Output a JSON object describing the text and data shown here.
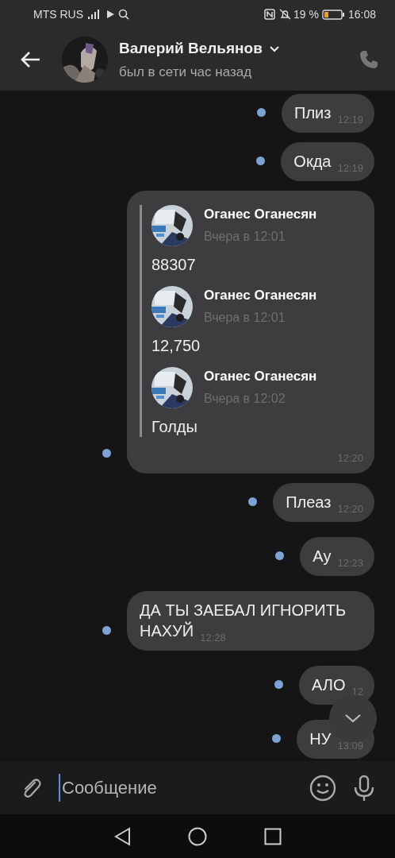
{
  "status_bar": {
    "carrier": "MTS RUS",
    "battery": "19 %",
    "time": "16:08"
  },
  "header": {
    "name": "Валерий Вельянов",
    "status": "был в сети час назад"
  },
  "messages": [
    {
      "kind": "text",
      "text": "Плиз",
      "time": "12:19",
      "unread": true
    },
    {
      "kind": "text",
      "text": "Окда",
      "time": "12:19",
      "unread": true
    },
    {
      "kind": "forward",
      "time": "12:20",
      "unread": true,
      "items": [
        {
          "sender": "Оганес Оганесян",
          "date": "Вчера в 12:01",
          "text": "88307"
        },
        {
          "sender": "Оганес Оганесян",
          "date": "Вчера в 12:01",
          "text": "12,750"
        },
        {
          "sender": "Оганес Оганесян",
          "date": "Вчера в 12:02",
          "text": "Голды"
        }
      ]
    },
    {
      "kind": "text",
      "text": "Плеаз",
      "time": "12:20",
      "unread": true
    },
    {
      "kind": "text",
      "text": "Ау",
      "time": "12:23",
      "unread": true
    },
    {
      "kind": "text",
      "text": "ДА ТЫ ЗАЕБАЛ ИГНОРИТЬ НАХУЙ",
      "time": "12:28",
      "unread": true
    },
    {
      "kind": "text",
      "text": "АЛО",
      "time": "12",
      "unread": true
    },
    {
      "kind": "text",
      "text": "НУ",
      "time": "13:09",
      "unread": true
    }
  ],
  "composer": {
    "placeholder": "Сообщение"
  }
}
